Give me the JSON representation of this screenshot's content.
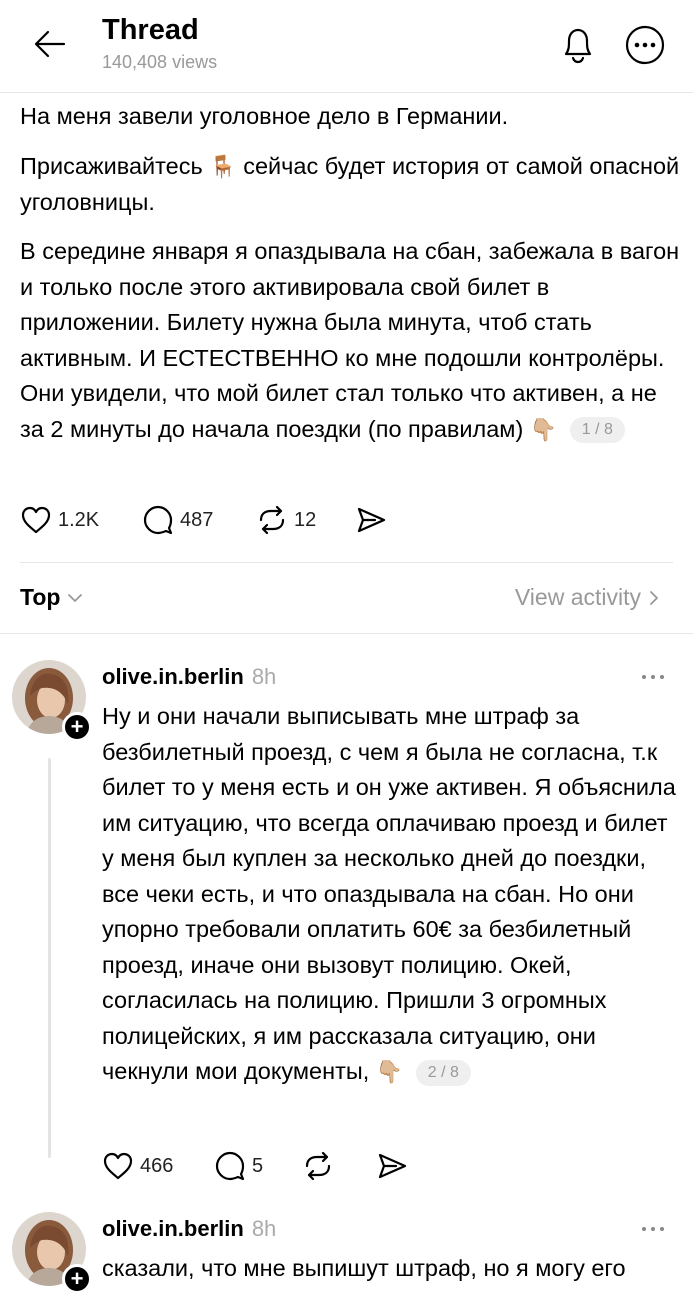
{
  "header": {
    "title": "Thread",
    "views": "140,408 views"
  },
  "post": {
    "paragraphs": [
      "На меня завели уголовное дело в Германии.",
      "Присаживайтесь",
      "сейчас будет история от самой опасной уголовницы.",
      "В середине января я опаздывала на сбан, забежала в вагон и только после этого активировала свой билет в приложении. Билету нужна была минута, чтоб стать активным. И ЕСТЕСТВЕННО ко мне подошли контролёры. Они увидели, что мой билет стал только что активен, а не за 2 минуты до начала поездки (по правилам)"
    ],
    "emoji_chair": "🪑",
    "emoji_point": "👇🏼",
    "page_indicator": "1 / 8",
    "likes": "1.2K",
    "comments": "487",
    "reposts": "12"
  },
  "sort": {
    "label": "Top",
    "view_activity": "View activity"
  },
  "replies": [
    {
      "username": "olive.in.berlin",
      "time": "8h",
      "text": "Ну и они начали выписывать мне штраф за безбилетный проезд, с чем я была не согласна, т.к билет то у меня есть и он уже активен. Я объяснила им ситуацию, что всегда оплачиваю проезд и билет у меня был куплен за несколько дней до поездки, все чеки есть, и что опаздывала на сбан. Но они упорно требовали оплатить 60€ за безбилетный проезд, иначе они вызовут полицию. Окей, согласилась на полицию. Пришли 3 огромных полицейских, я им рассказала ситуацию, они чекнули мои документы,",
      "emoji": "👇🏼",
      "page_indicator": "2 / 8",
      "likes": "466",
      "comments": "5"
    },
    {
      "username": "olive.in.berlin",
      "time": "8h",
      "text": "сказали, что мне выпишут штраф, но я могу его"
    }
  ],
  "colors": {
    "text": "#000000",
    "muted": "#999999",
    "divider": "#e6e6e6"
  }
}
